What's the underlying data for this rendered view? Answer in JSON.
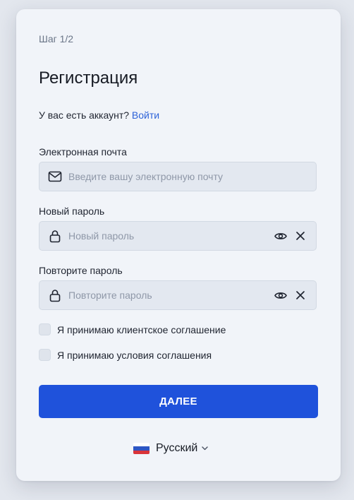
{
  "form": {
    "step": "Шаг 1/2",
    "title": "Регистрация",
    "account_prompt": "У вас есть аккаунт?",
    "login_link": "Войти"
  },
  "email": {
    "label": "Электронная почта",
    "placeholder": "Введите вашу электронную почту",
    "value": "",
    "icon": "mail-icon"
  },
  "password": {
    "label": "Новый пароль",
    "placeholder": "Новый пароль",
    "value": "",
    "icon": "lock-icon",
    "show_icon": "eye-icon",
    "clear_icon": "close-icon"
  },
  "password_repeat": {
    "label": "Повторите пароль",
    "placeholder": "Повторите пароль",
    "value": "",
    "icon": "lock-icon",
    "show_icon": "eye-icon",
    "clear_icon": "close-icon"
  },
  "checkboxes": [
    {
      "label": "Я принимаю клиентское соглашение",
      "checked": false
    },
    {
      "label": "Я принимаю условия соглашения",
      "checked": false
    }
  ],
  "next_button": {
    "label": "ДАЛЕЕ"
  },
  "language": {
    "label": "Русский",
    "flag_icon": "russia-flag-icon",
    "chevron_icon": "chevron-down-icon"
  },
  "colors": {
    "accent": "#1f52db",
    "link": "#2f63d8",
    "background": "#e3e7ee",
    "card": "#f1f4f9",
    "input_bg": "#e3e8f0"
  }
}
